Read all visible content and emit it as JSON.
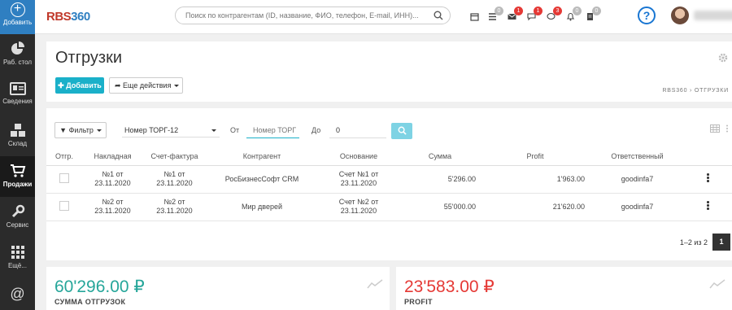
{
  "app": {
    "logo_part1": "RBS",
    "logo_part2": "360"
  },
  "sidebar": {
    "add_label": "Добавить",
    "items": [
      {
        "label": "Раб. стол",
        "icon": "pie-chart-icon"
      },
      {
        "label": "Сведения",
        "icon": "id-card-icon"
      },
      {
        "label": "Склад",
        "icon": "cubes-icon"
      },
      {
        "label": "Продажи",
        "icon": "cart-icon"
      },
      {
        "label": "Сервис",
        "icon": "wrench-icon"
      },
      {
        "label": "Ещё...",
        "icon": "grid-icon"
      },
      {
        "label": "",
        "icon": "at-icon"
      }
    ]
  },
  "topbar": {
    "search_placeholder": "Поиск по контрагентам (ID, название, ФИО, телефон, E-mail, ИНН)...",
    "badges": [
      "",
      "0",
      "1",
      "1",
      "3",
      "0",
      "0"
    ],
    "help": "?"
  },
  "header": {
    "title": "Отгрузки",
    "add_button": "Добавить",
    "more_button": "Еще действия",
    "breadcrumb": "RBS360 › ОТГРУЗКИ"
  },
  "filters": {
    "filter_button": "Фильтр",
    "field_select": "Номер ТОРГ-12",
    "from_label": "От",
    "from_placeholder": "Номер ТОРГ",
    "to_label": "До",
    "to_value": "0"
  },
  "table": {
    "columns": [
      "Отгр.",
      "Накладная",
      "Счет-фактура",
      "Контрагент",
      "Основание",
      "Сумма",
      "Profit",
      "Ответственный"
    ],
    "rows": [
      {
        "invoice1": "№1 от",
        "invoice2": "23.11.2020",
        "factura1": "№1 от",
        "factura2": "23.11.2020",
        "contractor": "РосБизнесСофт CRM",
        "basis1": "Счет №1 от",
        "basis2": "23.11.2020",
        "sum": "5'296.00",
        "profit": "1'963.00",
        "responsible": "goodinfa7"
      },
      {
        "invoice1": "№2 от",
        "invoice2": "23.11.2020",
        "factura1": "№2 от",
        "factura2": "23.11.2020",
        "contractor": "Мир дверей",
        "basis1": "Счет №2 от",
        "basis2": "23.11.2020",
        "sum": "55'000.00",
        "profit": "21'620.00",
        "responsible": "goodinfa7"
      }
    ],
    "pager_text": "1–2 из 2",
    "page": "1"
  },
  "stats": [
    {
      "value": "60'296.00 ₽",
      "caption": "СУММА ОТГРУЗОК",
      "color": "#26a69a"
    },
    {
      "value": "23'583.00 ₽",
      "caption": "PROFIT",
      "color": "#e53935"
    }
  ]
}
